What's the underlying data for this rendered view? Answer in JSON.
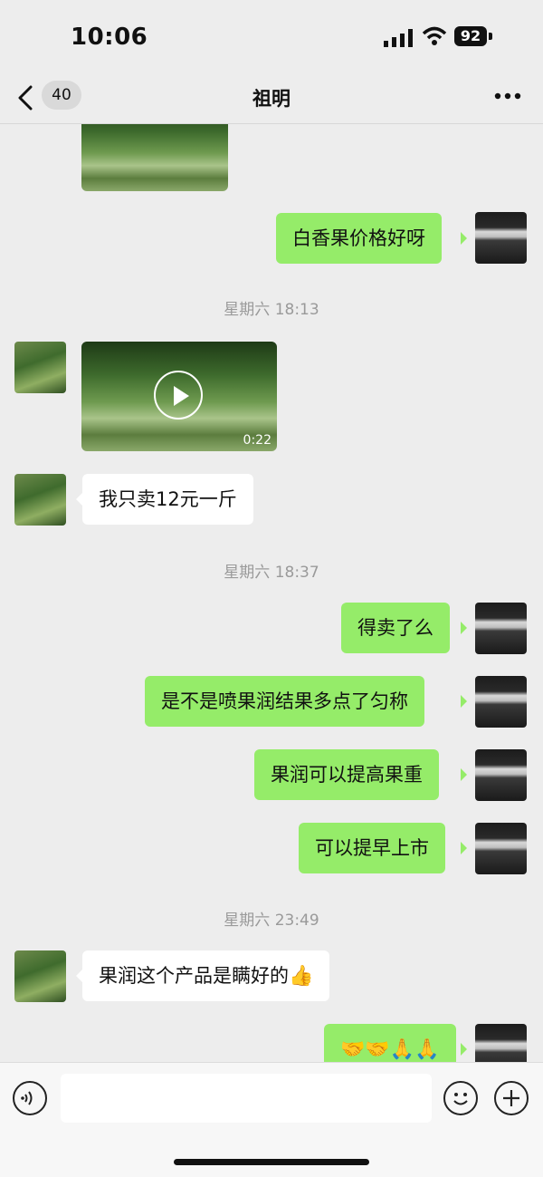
{
  "status_bar": {
    "time": "10:06",
    "battery": "92"
  },
  "header": {
    "unread_count": "40",
    "title": "祖明"
  },
  "messages": {
    "m1": {
      "text": "白香果价格好呀"
    },
    "ts1": "星期六 18:13",
    "video": {
      "duration": "0:22"
    },
    "m2": {
      "text": "我只卖12元一斤"
    },
    "ts2": "星期六 18:37",
    "m3": {
      "text": "得卖了么"
    },
    "m4": {
      "text": "是不是喷果润结果多点了匀称"
    },
    "m5": {
      "text": "果润可以提高果重"
    },
    "m6": {
      "text": "可以提早上市"
    },
    "ts3": "星期六 23:49",
    "m7": {
      "text": "果润这个产品是瞒好的",
      "emoji": "👍"
    },
    "m8": {
      "emoji": "🤝🤝🙏🙏"
    }
  },
  "colors": {
    "outgoing_bubble": "#95ec69",
    "incoming_bubble": "#ffffff",
    "background": "#ededed"
  },
  "icons": [
    "back-chevron-icon",
    "more-icon",
    "play-icon",
    "voice-icon",
    "emoji-icon",
    "plus-icon",
    "signal-icon",
    "wifi-icon",
    "battery-icon"
  ]
}
